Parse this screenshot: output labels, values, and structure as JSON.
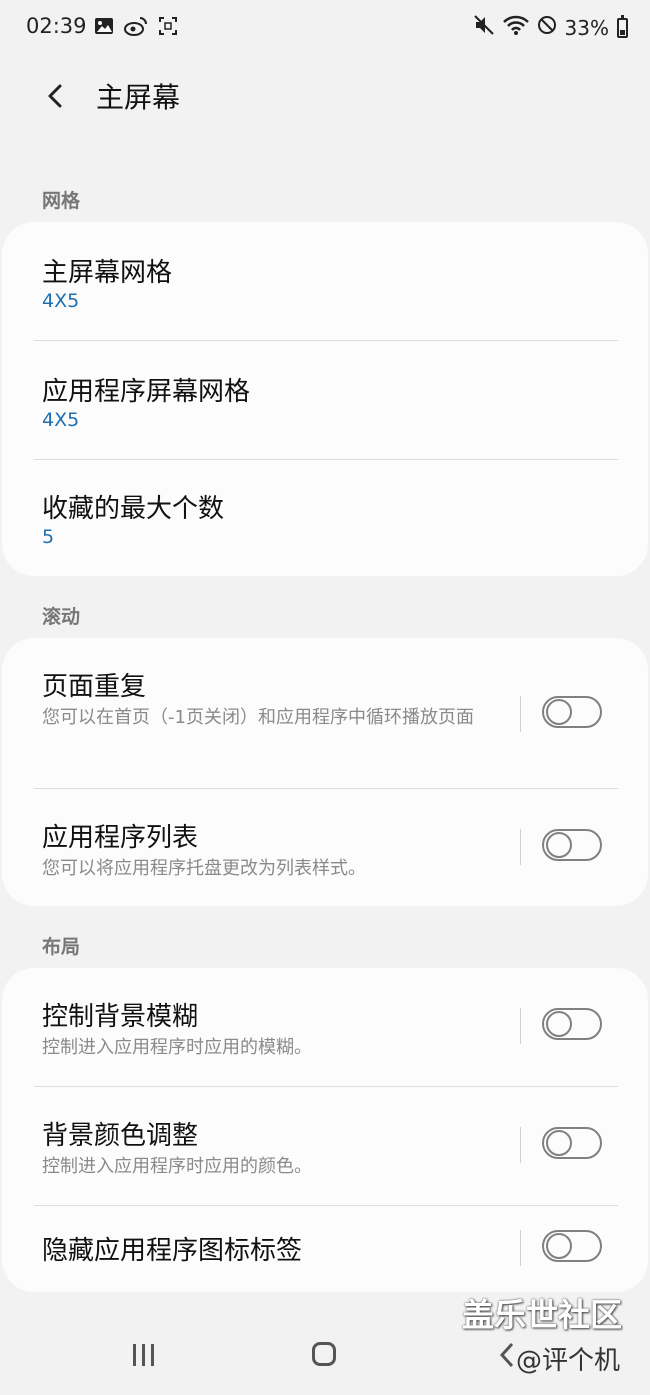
{
  "status_bar": {
    "time": "02:39",
    "battery": "33%",
    "battery_level": 0.33,
    "left_icons": [
      "gallery-icon",
      "weibo-icon",
      "screenshot-icon"
    ],
    "right_icons": [
      "mute-icon",
      "wifi-icon",
      "dnd-icon",
      "battery-icon"
    ]
  },
  "header": {
    "title": "主屏幕",
    "back_icon": "chevron-left-icon"
  },
  "sections": {
    "grid": {
      "label": "网格",
      "items": [
        {
          "title": "主屏幕网格",
          "value": "4X5"
        },
        {
          "title": "应用程序屏幕网格",
          "value": "4X5"
        },
        {
          "title": "收藏的最大个数",
          "value": "5"
        }
      ]
    },
    "scroll": {
      "label": "滚动",
      "items": [
        {
          "title": "页面重复",
          "desc": "您可以在首页（-1页关闭）和应用程序中循环播放页面",
          "enabled": false
        },
        {
          "title": "应用程序列表",
          "desc": "您可以将应用程序托盘更改为列表样式。",
          "enabled": false
        }
      ]
    },
    "layout": {
      "label": "布局",
      "items": [
        {
          "title": "控制背景模糊",
          "desc": "控制进入应用程序时应用的模糊。",
          "enabled": false
        },
        {
          "title": "背景颜色调整",
          "desc": "控制进入应用程序时应用的颜色。",
          "enabled": false
        },
        {
          "title": "隐藏应用程序图标标签",
          "enabled": false
        }
      ]
    }
  },
  "watermark": {
    "line1": "盖乐世社区",
    "line2": "@评个机"
  },
  "colors": {
    "value_blue": "#1e6fb2",
    "background": "#f2f2f2",
    "card": "#fcfcfc"
  }
}
